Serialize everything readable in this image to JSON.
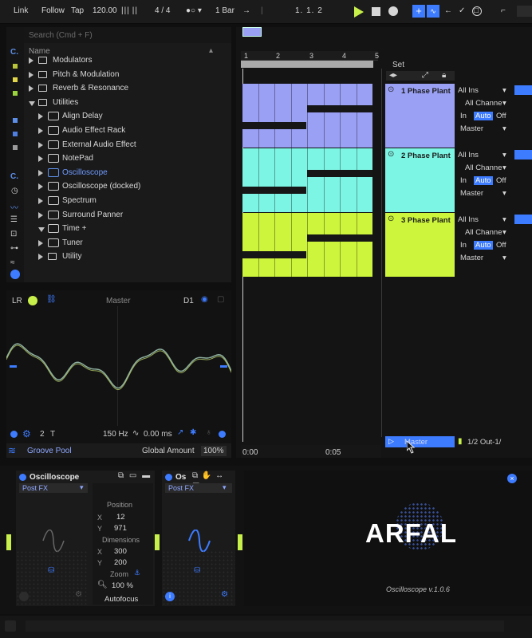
{
  "transport": {
    "link": "Link",
    "follow": "Follow",
    "tap": "Tap",
    "tempo": "120.00",
    "time_signature": "4 / 4",
    "quantize": "1 Bar",
    "position": "1.  1.  2"
  },
  "browser": {
    "search_placeholder": "Search (Cmd + F)",
    "column_header": "Name",
    "items": [
      {
        "label": "Modulators",
        "kind": "folder",
        "indent": 0
      },
      {
        "label": "Pitch & Modulation",
        "kind": "folder",
        "indent": 0
      },
      {
        "label": "Reverb & Resonance",
        "kind": "folder",
        "indent": 0
      },
      {
        "label": "Utilities",
        "kind": "folder-open",
        "indent": 0
      },
      {
        "label": "Align Delay",
        "kind": "device",
        "indent": 1
      },
      {
        "label": "Audio Effect Rack",
        "kind": "device",
        "indent": 1
      },
      {
        "label": "External Audio Effect",
        "kind": "device",
        "indent": 1
      },
      {
        "label": "NotePad",
        "kind": "device",
        "indent": 1
      },
      {
        "label": "Oscilloscope",
        "kind": "device",
        "indent": 1,
        "selected": true
      },
      {
        "label": "Oscilloscope (docked)",
        "kind": "device",
        "indent": 1
      },
      {
        "label": "Spectrum",
        "kind": "device",
        "indent": 1
      },
      {
        "label": "Surround Panner",
        "kind": "device",
        "indent": 1
      },
      {
        "label": "Time +",
        "kind": "device-open",
        "indent": 1
      },
      {
        "label": "Tuner",
        "kind": "device",
        "indent": 1
      },
      {
        "label": "Utility",
        "kind": "folder",
        "indent": 1
      }
    ],
    "sidebar_labels": [
      "C.",
      "C."
    ],
    "color_tags": [
      "#b9c63a",
      "#e2d64a",
      "#9bd33d",
      "#5d8fe9",
      "#4f7fe0",
      "#9b9b9b"
    ]
  },
  "arrangement": {
    "ruler_marks": [
      "1",
      "2",
      "3",
      "4",
      "5"
    ],
    "set_label": "Set",
    "time_marks": [
      "0:00",
      "0:05"
    ],
    "tracks": [
      {
        "name": "1 Phase Plant",
        "color": "#9aa0f4",
        "input": "All Ins",
        "channel": "All Channe",
        "in": "In",
        "auto": "Auto",
        "off": "Off",
        "output": "Master"
      },
      {
        "name": "2 Phase Plant",
        "color": "#7df5e4",
        "input": "All Ins",
        "channel": "All Channe",
        "in": "In",
        "auto": "Auto",
        "off": "Off",
        "output": "Master"
      },
      {
        "name": "3 Phase Plant",
        "color": "#cdf53c",
        "input": "All Ins",
        "channel": "All Channe",
        "in": "In",
        "auto": "Auto",
        "off": "Off",
        "output": "Master"
      }
    ],
    "master": {
      "name": "Master",
      "output": "1/2 Out-1/"
    }
  },
  "scope": {
    "lr": "LR",
    "title": "Master",
    "d1": "D1",
    "two": "2",
    "t": "T",
    "freq": "150 Hz",
    "time": "0.00 ms"
  },
  "groove": {
    "label": "Groove Pool",
    "global": "Global Amount",
    "amount": "100%"
  },
  "device1": {
    "title": "Oscilloscope",
    "mode": "Post FX",
    "position_label": "Position",
    "x": "12",
    "y": "971",
    "dimensions_label": "Dimensions",
    "w": "300",
    "h": "200",
    "zoom_label": "Zoom",
    "zoom": "100 %",
    "autofocus": "Autofocus",
    "x_label": "X",
    "y_label": "Y"
  },
  "device2": {
    "title": "Os",
    "mode": "Post FX"
  },
  "device3": {
    "brand": "ARFAL",
    "version": "Oscilloscope v.1.0.6"
  },
  "colors": {
    "accent": "#3d7bff",
    "transport_play": "#c8f04a"
  }
}
